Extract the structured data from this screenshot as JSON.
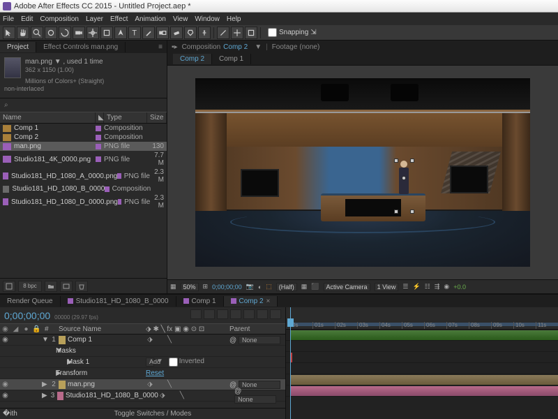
{
  "app": {
    "title": "Adobe After Effects CC 2015 - Untitled Project.aep *"
  },
  "menu": [
    "File",
    "Edit",
    "Composition",
    "Layer",
    "Effect",
    "Animation",
    "View",
    "Window",
    "Help"
  ],
  "snapping_label": "Snapping",
  "project": {
    "tab_project": "Project",
    "tab_effects": "Effect Controls man.png",
    "asset": {
      "name": "man.png ▼ , used 1 time",
      "dims": "362 x 1150 (1.00)",
      "color": "Millions of Colors+ (Straight)",
      "interlace": "non-interlaced"
    },
    "search_icon": "⌕",
    "cols": {
      "name": "Name",
      "type": "Type",
      "size": "Size"
    },
    "items": [
      {
        "name": "Comp 1",
        "type": "Composition",
        "size": "",
        "kind": "comp"
      },
      {
        "name": "Comp 2",
        "type": "Composition",
        "size": "",
        "kind": "comp"
      },
      {
        "name": "man.png",
        "type": "PNG file",
        "size": "130",
        "kind": "png",
        "selected": true
      },
      {
        "name": "Studio181_4K_0000.png",
        "type": "PNG file",
        "size": "7.7 M",
        "kind": "png"
      },
      {
        "name": "Studio181_HD_1080_A_0000.png",
        "type": "PNG file",
        "size": "2.3 M",
        "kind": "png"
      },
      {
        "name": "Studio181_HD_1080_B_0000",
        "type": "Composition",
        "size": "",
        "kind": "folder"
      },
      {
        "name": "Studio181_HD_1080_D_0000.png",
        "type": "PNG file",
        "size": "2.3 M",
        "kind": "png"
      }
    ]
  },
  "viewer": {
    "comp_prefix": "Composition",
    "comp_name": "Comp 2",
    "footage_prefix": "Footage",
    "footage_name": "(none)",
    "tabs": [
      {
        "label": "Comp 2",
        "active": true
      },
      {
        "label": "Comp 1",
        "active": false
      }
    ],
    "footer": {
      "zoom": "50%",
      "time": "0;00;00;00",
      "res": "(Half)",
      "camera": "Active Camera",
      "views": "1 View",
      "exposure": "+0.0"
    }
  },
  "timeline": {
    "tabs": [
      {
        "label": "Render Queue",
        "active": false
      },
      {
        "label": "Studio181_HD_1080_B_0000",
        "active": false,
        "hasdot": true
      },
      {
        "label": "Comp 1",
        "active": false,
        "hasdot": true
      },
      {
        "label": "Comp 2",
        "active": true,
        "hasdot": true
      }
    ],
    "timecode": "0;00;00;00",
    "timecode_sub": "00000 (29.97 fps)",
    "header": {
      "num": "#",
      "source": "Source Name",
      "parent": "Parent"
    },
    "rows": [
      {
        "num": "1",
        "name": "Comp 1",
        "color": "#b8a05a",
        "parent": "None",
        "twirl": "▼",
        "eye": true
      },
      {
        "sub": 1,
        "name": "Masks",
        "twirl": "▼"
      },
      {
        "sub": 2,
        "name": "Mask 1",
        "mode": "Add",
        "inverted_label": "Inverted",
        "twirl": "▶"
      },
      {
        "sub": 1,
        "name": "Transform",
        "reset": "Reset",
        "twirl": "▶"
      },
      {
        "num": "2",
        "name": "man.png",
        "color": "#b8a05a",
        "parent": "None",
        "selected": true,
        "twirl": "▶",
        "eye": true
      },
      {
        "num": "3",
        "name": "Studio181_HD_1080_B_0000",
        "color": "#b86a8a",
        "parent": "None",
        "twirl": "▶",
        "eye": true
      }
    ],
    "ruler": [
      "0s",
      "01s",
      "02s",
      "03s",
      "04s",
      "05s",
      "06s",
      "07s",
      "08s",
      "09s",
      "10s",
      "11s"
    ],
    "toggle": "Toggle Switches / Modes"
  }
}
